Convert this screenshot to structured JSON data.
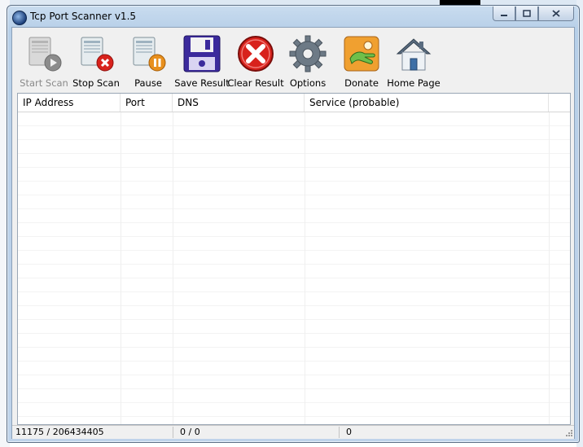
{
  "window": {
    "title": "Tcp Port Scanner v1.5",
    "caption_minimize": "▭",
    "caption_maximize": "▢",
    "caption_close": "✕"
  },
  "toolbar": {
    "buttons": [
      {
        "label": "Start Scan",
        "icon": "start-scan-icon",
        "enabled": false
      },
      {
        "label": "Stop Scan",
        "icon": "stop-scan-icon",
        "enabled": true
      },
      {
        "label": "Pause",
        "icon": "pause-icon",
        "enabled": true
      },
      {
        "label": "Save Result",
        "icon": "floppy-disk-icon",
        "enabled": true
      },
      {
        "label": "Clear Result",
        "icon": "clear-x-icon",
        "enabled": true
      },
      {
        "label": "Options",
        "icon": "gear-icon",
        "enabled": true
      },
      {
        "label": "Donate",
        "icon": "donate-hand-icon",
        "enabled": true
      },
      {
        "label": "Home Page",
        "icon": "home-icon",
        "enabled": true
      }
    ]
  },
  "results_table": {
    "columns": [
      "IP Address",
      "Port",
      "DNS",
      "Service (probable)"
    ],
    "rows": []
  },
  "statusbar": {
    "progress": "11175 / 206434405",
    "open_ports": "0 / 0",
    "found": "0"
  },
  "colors": {
    "accent": "#1c3f7a",
    "stop_red": "#d8221c",
    "pause_orange": "#e8901e",
    "donate_orange": "#f0a030",
    "window_frame": "#bfd3ea"
  }
}
